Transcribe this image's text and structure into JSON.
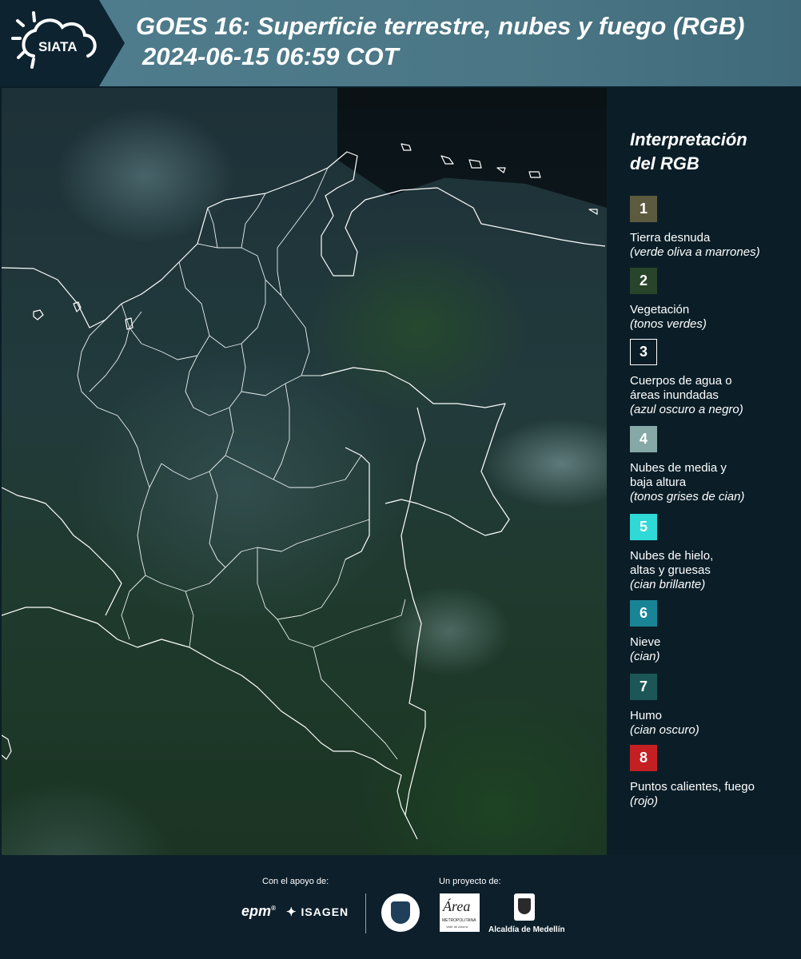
{
  "header": {
    "logo_text": "SIATA",
    "title_line1": "GOES 16: Superficie terrestre, nubes y fuego (RGB)",
    "title_line2": "2024-06-15 06:59 COT"
  },
  "legend": {
    "title_line1": "Interpretación",
    "title_line2": "del RGB",
    "items": [
      {
        "number": "1",
        "label": "Tierra desnuda",
        "sub": "(verde oliva a marrones)",
        "color": "#5c5b3f"
      },
      {
        "number": "2",
        "label": "Vegetación",
        "sub": "(tonos verdes)",
        "color": "#28442a"
      },
      {
        "number": "3",
        "label": "Cuerpos de agua o áreas inundadas",
        "sub": "(azul oscuro a negro)",
        "color": "#0b1e28"
      },
      {
        "number": "4",
        "label": "Nubes de media y baja altura",
        "sub": "(tonos grises de cian)",
        "color": "#86a8a6"
      },
      {
        "number": "5",
        "label": "Nubes de hielo, altas y gruesas",
        "sub": "(cian brillante)",
        "color": "#2fd9d6"
      },
      {
        "number": "6",
        "label": "Nieve",
        "sub": "(cian)",
        "color": "#1a8497"
      },
      {
        "number": "7",
        "label": "Humo",
        "sub": "(cian oscuro)",
        "color": "#1d5656"
      },
      {
        "number": "8",
        "label": "Puntos calientes, fuego",
        "sub": "(rojo)",
        "color": "#c42024"
      }
    ]
  },
  "footer": {
    "support_label": "Con el apoyo de:",
    "project_label": "Un proyecto de:",
    "sponsor_epm": "epm",
    "sponsor_isagen": "ISAGEN",
    "area_text": "METROPOLITANA",
    "area_sub": "Valle de Aburrá",
    "alcaldia": "Alcaldía de Medellín"
  }
}
